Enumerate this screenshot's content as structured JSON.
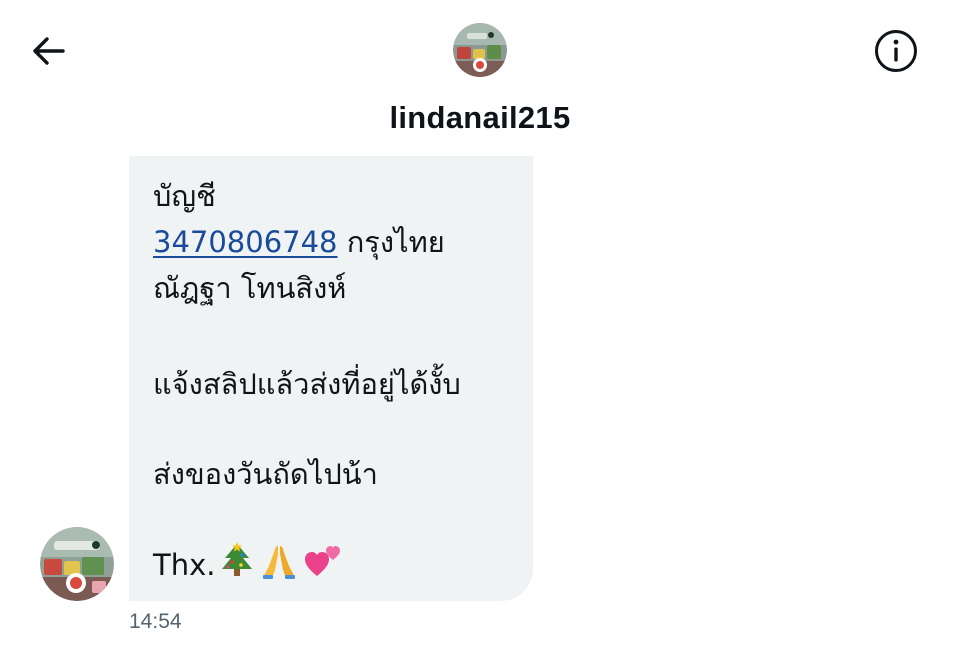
{
  "header": {
    "username": "lindanail215",
    "back_icon": "arrow-left-icon",
    "info_icon": "info-icon"
  },
  "message": {
    "line_account_label": "บัญชี",
    "account_number": "3470806748",
    "bank_name": "กรุงไทย",
    "account_name": "ณัฎฐา โทนสิงห์",
    "line_slip": "แจ้งสลิปแล้วส่งที่อยู่ได้งั้บ",
    "line_ship": "ส่งของวันถัดไปน้า",
    "line_thanks": "Thx.",
    "thanks_emojis": [
      "christmas-tree-icon",
      "folded-hands-icon",
      "two-hearts-icon"
    ],
    "timestamp": "14:54"
  },
  "colors": {
    "bubble": "#eff3f4",
    "link": "#1a4a9a",
    "text": "#0f1419",
    "muted": "#536471"
  }
}
